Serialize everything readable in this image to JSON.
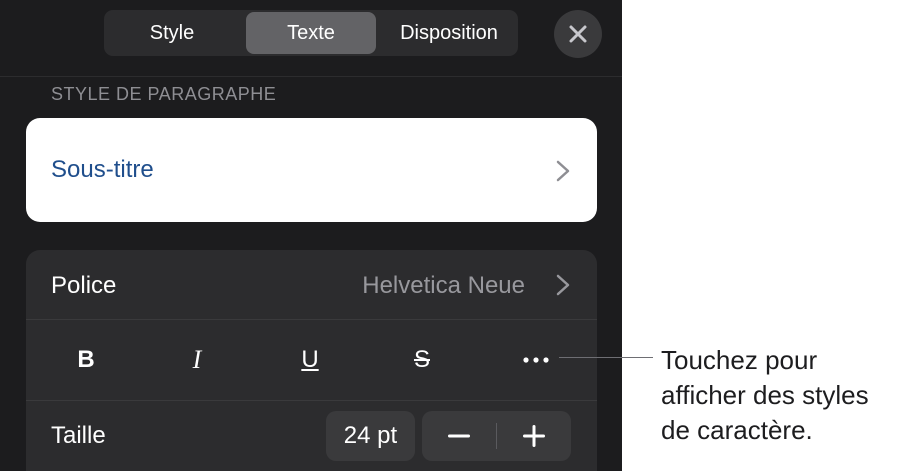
{
  "tabs": [
    {
      "label": "Style",
      "active": false
    },
    {
      "label": "Texte",
      "active": true
    },
    {
      "label": "Disposition",
      "active": false
    }
  ],
  "close_icon": "close-icon",
  "paragraph_style": {
    "section_title": "STYLE DE PARAGRAPHE",
    "current": "Sous-titre"
  },
  "font": {
    "label": "Police",
    "value": "Helvetica Neue"
  },
  "character_styles": {
    "bold": "B",
    "italic": "I",
    "underline": "U",
    "strikethrough": "S",
    "more_icon": "more-dots-icon"
  },
  "size": {
    "label": "Taille",
    "value": "24 pt"
  },
  "callout": {
    "line1": "Touchez pour",
    "line2": "afficher des styles",
    "line3": "de caractère."
  },
  "colors": {
    "panel_bg": "#1c1c1e",
    "accent_text": "#1f4e8c",
    "active_tab": "#636366"
  }
}
